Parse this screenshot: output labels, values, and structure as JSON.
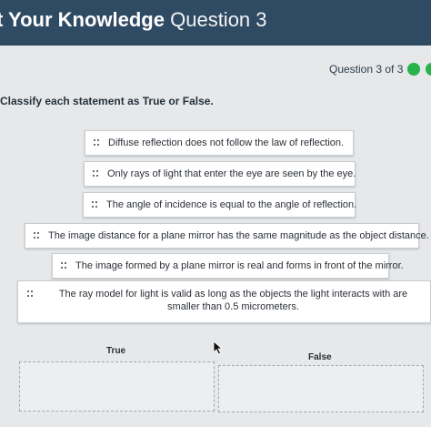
{
  "header": {
    "title_bold": "t Your Knowledge",
    "title_light": "Question 3"
  },
  "progress": {
    "label": "Question 3 of 3",
    "dot_color": "#27b24a"
  },
  "instruction": "Classify each statement as True or False.",
  "statements": [
    "Diffuse reflection does not follow the law of reflection.",
    "Only rays of light that enter the eye are seen by the eye.",
    "The angle of incidence is equal to the angle of reflection.",
    "The image distance for a plane mirror has the same magnitude as the object distance.",
    "The image formed by a plane mirror is real and forms in front of the mirror.",
    "The ray model for light is valid as long as the objects the light interacts with are smaller than 0.5 micrometers."
  ],
  "drop_zones": {
    "true_label": "True",
    "false_label": "False"
  },
  "icons": {
    "drag_handle": "drag-handle-icon",
    "cursor": "mouse-pointer-icon"
  }
}
